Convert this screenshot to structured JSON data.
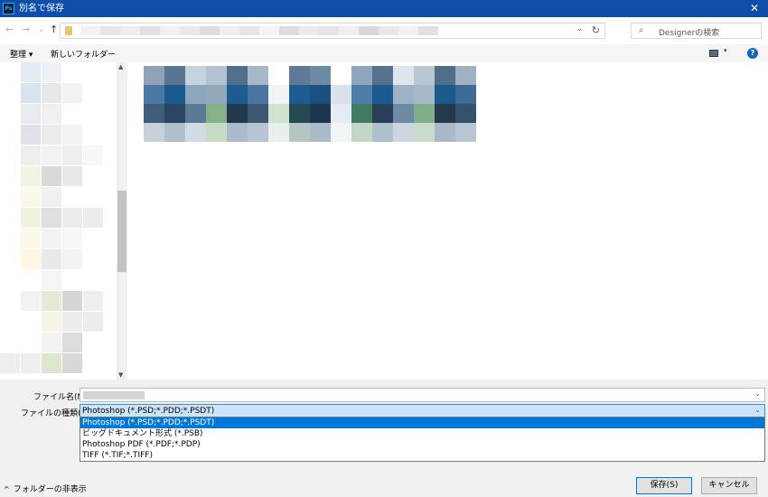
{
  "window": {
    "title": "別名で保存",
    "app_icon_text": "Ps",
    "close_glyph": "✕"
  },
  "nav": {
    "back_glyph": "←",
    "forward_glyph": "→",
    "recent_glyph": "⌄",
    "up_glyph": "↑",
    "refresh_glyph": "↻",
    "dropdown_glyph": "⌄"
  },
  "search": {
    "placeholder": "Designerの検索",
    "icon_glyph": "⌕"
  },
  "toolbar": {
    "organize_label": "整理 ▾",
    "new_folder_label": "新しいフォルダー",
    "help_glyph": "?",
    "view_dropdown_glyph": "▾"
  },
  "form": {
    "filename_label": "ファイル名(N):",
    "filetype_label": "ファイルの種類(T):",
    "filetype_value": "Photoshop (*.PSD;*.PDD;*.PSDT)",
    "filetype_options": [
      "Photoshop (*.PSD;*.PDD;*.PSDT)",
      "ビッグドキュメント形式 (*.PSB)",
      "Photoshop PDF (*.PDF;*.PDP)",
      "TIFF (*.TIF;*.TIFF)"
    ],
    "chevron_glyph": "⌄"
  },
  "footer": {
    "hide_folders_label": "フォルダーの非表示",
    "hide_folders_glyph": "^",
    "save_label": "保存(S)",
    "cancel_label": "キャンセル"
  },
  "colors": {
    "titlebar": "#0e4ea8",
    "selection": "#0078d7",
    "selected_field": "#cce4f7"
  },
  "icons": {
    "app": "photoshop-icon",
    "close": "close-icon",
    "back": "back-arrow-icon",
    "forward": "forward-arrow-icon",
    "up": "up-arrow-icon",
    "folder": "folder-icon",
    "refresh": "refresh-icon",
    "search": "search-icon",
    "view": "view-options-icon",
    "help": "help-icon"
  },
  "blurred_thumbnail_colors": [
    "#8fa3b8",
    "#5a7590",
    "#c5d3df",
    "#b3c2d0",
    "#4f6f8c",
    "#a8b8c8",
    "#ffffff",
    "#5e7a96",
    "#6d8aa5",
    "#ffffff",
    "#8ea5bb",
    "#56718c",
    "#dde6ee",
    "#b9c7d4",
    "#506d89",
    "#9fb2c4",
    "#4a7aa3",
    "#1b5a8f",
    "#8ca6bd",
    "#93a8bb",
    "#1d5b90",
    "#4b75a0",
    "#f0f4f7",
    "#1d5b90",
    "#1b4f7f",
    "#d9e2ea",
    "#4d7ea7",
    "#1a5a8e",
    "#9db2c4",
    "#a6b9c9",
    "#1b5a8f",
    "#3e6a95",
    "#3f5d79",
    "#2a4661",
    "#5a7a95",
    "#86b08a",
    "#24384d",
    "#3b5874",
    "#cfe3cf",
    "#254a50",
    "#1d3650",
    "#e6edf2",
    "#3f7a61",
    "#283f57",
    "#6e8aa5",
    "#7fae8a",
    "#26384c",
    "#33506c",
    "#c5d1db",
    "#b0bfcc",
    "#d2dce5",
    "#c7dbc4",
    "#aabbc9",
    "#b7c5d2",
    "#e9f0ea",
    "#b3c6c0",
    "#a9bac8",
    "#f1f5f8",
    "#c2d7c6",
    "#b0bfcc",
    "#cbd6df",
    "#c8dcc9",
    "#a9b9c7",
    "#b8c7d3"
  ],
  "blurred_nav_colors": [
    "#ffffff",
    "#e3ebf3",
    "#eef2f6",
    "#ffffff",
    "#ffffff",
    "#ffffff",
    "#d6e4f2",
    "#e6e9ec",
    "#f2f2f2",
    "#ffffff",
    "#ffffff",
    "#e9ecef",
    "#f0f0f0",
    "#ffffff",
    "#ffffff",
    "#ffffff",
    "#dfe3e7",
    "#ebebeb",
    "#f3f3f3",
    "#ffffff",
    "#ffffff",
    "#eeeeee",
    "#f2f2f2",
    "#eeeeee",
    "#f7f7f7",
    "#ffffff",
    "#f3f1e6",
    "#d9d9d9",
    "#e8e8e8",
    "#ffffff",
    "#ffffff",
    "#fbf9ea",
    "#f0f0f0",
    "#ffffff",
    "#ffffff",
    "#ffffff",
    "#eef3dc",
    "#dedede",
    "#ececec",
    "#ececec",
    "#ffffff",
    "#fcf8ea",
    "#f2f2f2",
    "#f7f7f7",
    "#ffffff",
    "#ffffff",
    "#fff7e2",
    "#e9e9e9",
    "#f2f2f2",
    "#ffffff",
    "#ffffff",
    "#ffffff",
    "#f5f5f5",
    "#ffffff",
    "#ffffff",
    "#ffffff",
    "#f2f2f2",
    "#e5ead7",
    "#d6d6d6",
    "#eeeeee",
    "#ffffff",
    "#ffffff",
    "#f7f3e6",
    "#ececec",
    "#ededed",
    "#ffffff",
    "#ffffff",
    "#f3f3f3",
    "#dcdcdc",
    "#ffffff",
    "#eeeeee",
    "#eeeeee",
    "#dde6cf",
    "#d8d8d8",
    "#ffffff"
  ],
  "blurred_path_colors": [
    "#f2f2f2",
    "#e6e6e6",
    "#ededed",
    "#e1e1e1",
    "#f0f0f0",
    "#e9e9e9",
    "#dedede",
    "#eeeeee",
    "#e5e5e5",
    "#f3f3f3",
    "#dcdcdc",
    "#ebebeb",
    "#e4e4e4",
    "#efefef",
    "#d9d9d9",
    "#e8e8e8",
    "#f1f1f1",
    "#e0e0e0"
  ]
}
